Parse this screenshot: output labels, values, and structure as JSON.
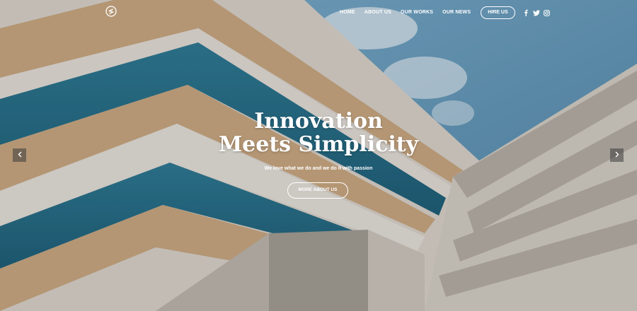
{
  "brand": {
    "logo_icon": "s-logo-icon"
  },
  "nav": {
    "items": [
      {
        "label": "HOME"
      },
      {
        "label": "ABOUT US"
      },
      {
        "label": "OUR WORKS"
      },
      {
        "label": "OUR NEWS"
      }
    ],
    "hire_label": "HIRE US",
    "social": [
      "facebook-icon",
      "twitter-icon",
      "instagram-icon"
    ]
  },
  "hero": {
    "title_line1": "Innovation",
    "title_line2": "Meets Simplicity",
    "tagline": "We love what we do and we do it with passion",
    "cta_label": "MORE ABOUT US"
  },
  "slider": {
    "prev_icon": "chevron-left-icon",
    "next_icon": "chevron-right-icon"
  }
}
